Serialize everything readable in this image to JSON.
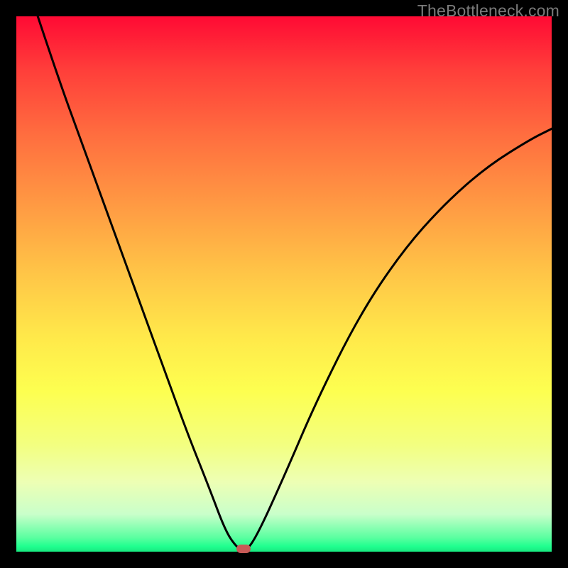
{
  "watermark": "TheBottleneck.com",
  "chart_data": {
    "type": "line",
    "title": "",
    "xlabel": "",
    "ylabel": "",
    "xlim": [
      0,
      100
    ],
    "ylim": [
      0,
      100
    ],
    "grid": false,
    "legend": false,
    "series": [
      {
        "name": "curve",
        "x": [
          4,
          8,
          12,
          16,
          20,
          24,
          28,
          32,
          36,
          39,
          41,
          42.5,
          44.5,
          50,
          56,
          64,
          72,
          80,
          88,
          96,
          100
        ],
        "y": [
          100,
          88,
          77,
          66,
          55,
          44,
          33,
          22,
          12,
          4,
          1,
          0,
          2,
          14,
          28,
          44,
          56,
          65,
          72,
          77,
          79
        ]
      }
    ],
    "marker": {
      "x": 42.5,
      "y": 0.5,
      "color": "#c85a57"
    },
    "background_gradient": {
      "top": "#ff0a34",
      "middle": "#ffe94a",
      "bottom": "#18e880"
    }
  }
}
